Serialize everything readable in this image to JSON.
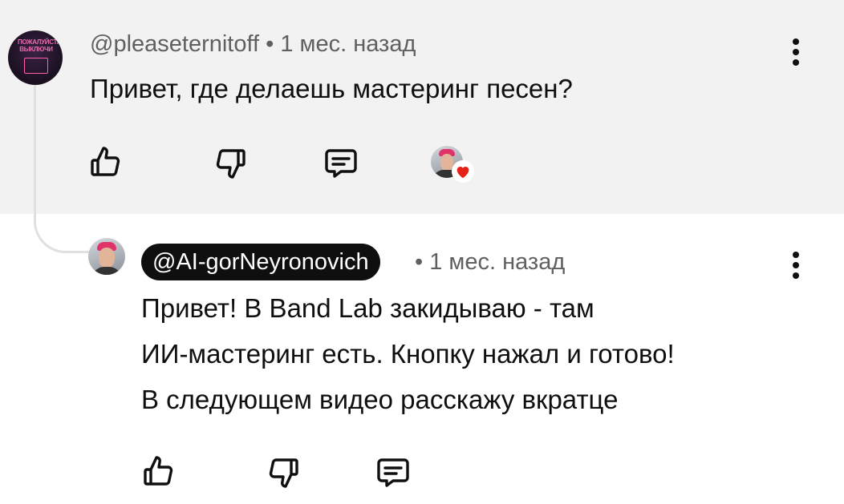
{
  "comment": {
    "author": "@pleaseternitoff",
    "age": "1 мес. назад",
    "separator": "•",
    "text": "Привет, где делаешь мастеринг песен?",
    "avatar_text": "ПОЖАЛУЙСТА, ВЫКЛЮЧИ",
    "like_icon": "thumb-up-icon",
    "dislike_icon": "thumb-down-icon",
    "reply_icon": "reply-comment-icon",
    "hearted_icon": "heart-icon"
  },
  "reply": {
    "author": "@AI-gorNeyronovich",
    "age": "1 мес. назад",
    "separator": "•",
    "lines": [
      "Привет! В Band Lab закидываю - там",
      "ИИ-мастеринг есть. Кнопку нажал и готово!",
      "В следующем видео расскажу вкратце"
    ]
  },
  "colors": {
    "top_bg": "#f2f2f2",
    "meta": "#606060",
    "text": "#0f0f0f",
    "heart": "#e62117",
    "chip_bg": "#0f0f0f"
  }
}
